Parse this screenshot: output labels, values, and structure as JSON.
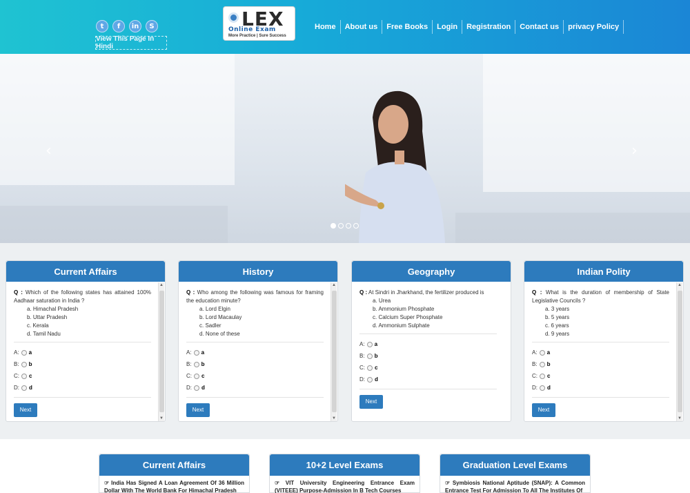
{
  "header": {
    "socials": [
      "t",
      "f",
      "in",
      "S"
    ],
    "hindi_button": "View This Page In Hindi",
    "logo": {
      "name": "LEX",
      "tagline": "Online Exam",
      "subtagline": "More Practice | Sure Success"
    },
    "nav": [
      "Home",
      "About us",
      "Free Books",
      "Login",
      "Registration",
      "Contact us",
      "privacy Policy"
    ]
  },
  "carousel": {
    "prev": "‹",
    "next": "›",
    "dots_active": 0
  },
  "quizzes": [
    {
      "title": "Current Affairs",
      "question_prefix": "Q :",
      "question": "Which of the following states has attained 100% Aadhaar saturation in India ?",
      "options": [
        "a. Himachal Pradesh",
        "b. Uttar Pradesh",
        "c. Kerala",
        "d. Tamil Nadu"
      ],
      "answers": [
        {
          "label": "A:",
          "value": "a"
        },
        {
          "label": "B:",
          "value": "b"
        },
        {
          "label": "C:",
          "value": "c"
        },
        {
          "label": "D:",
          "value": "d"
        }
      ],
      "next": "Next"
    },
    {
      "title": "History",
      "question_prefix": "Q :",
      "question": "Who among the following was famous for framing the education minute?",
      "options": [
        "a. Lord Elgin",
        "b. Lord Macaulay",
        "c. Sadler",
        "d. None of these"
      ],
      "answers": [
        {
          "label": "A:",
          "value": "a"
        },
        {
          "label": "B:",
          "value": "b"
        },
        {
          "label": "C:",
          "value": "c"
        },
        {
          "label": "D:",
          "value": "d"
        }
      ],
      "next": "Next"
    },
    {
      "title": "Geography",
      "question_prefix": "Q :",
      "question": "At Sindri in Jharkhand, the fertilizer produced is",
      "options": [
        "a. Urea",
        "b. Ammonium Phosphate",
        "c. Calcium Super Phosphate",
        "d. Ammonium Sulphate"
      ],
      "answers": [
        {
          "label": "A:",
          "value": "a"
        },
        {
          "label": "B:",
          "value": "b"
        },
        {
          "label": "C:",
          "value": "c"
        },
        {
          "label": "D:",
          "value": "d"
        }
      ],
      "next": "Next"
    },
    {
      "title": "Indian Polity",
      "question_prefix": "Q :",
      "question": "What is the duration of membership of State Legislative Councils ?",
      "options": [
        "a. 3 years",
        "b. 5 years",
        "c. 6 years",
        "d. 9 years"
      ],
      "answers": [
        {
          "label": "A:",
          "value": "a"
        },
        {
          "label": "B:",
          "value": "b"
        },
        {
          "label": "C:",
          "value": "c"
        },
        {
          "label": "D:",
          "value": "d"
        }
      ],
      "next": "Next"
    }
  ],
  "sections": [
    {
      "title": "Current Affairs",
      "text": "India Has Signed A Loan Agreement Of 36 Million Dollar With The World Bank For Himachal Pradesh"
    },
    {
      "title": "10+2 Level Exams",
      "text": "VIT University Engineering Entrance Exam (VITEEE) Purpose-Admission In B Tech Courses"
    },
    {
      "title": "Graduation Level Exams",
      "text": "Symbiosis National Aptitude (SNAP): A Common Entrance Test For Admission To All The Institutes Of"
    }
  ],
  "colors": {
    "header_start": "#1fc3d2",
    "header_end": "#1b86d6",
    "accent": "#2d7bbd"
  }
}
